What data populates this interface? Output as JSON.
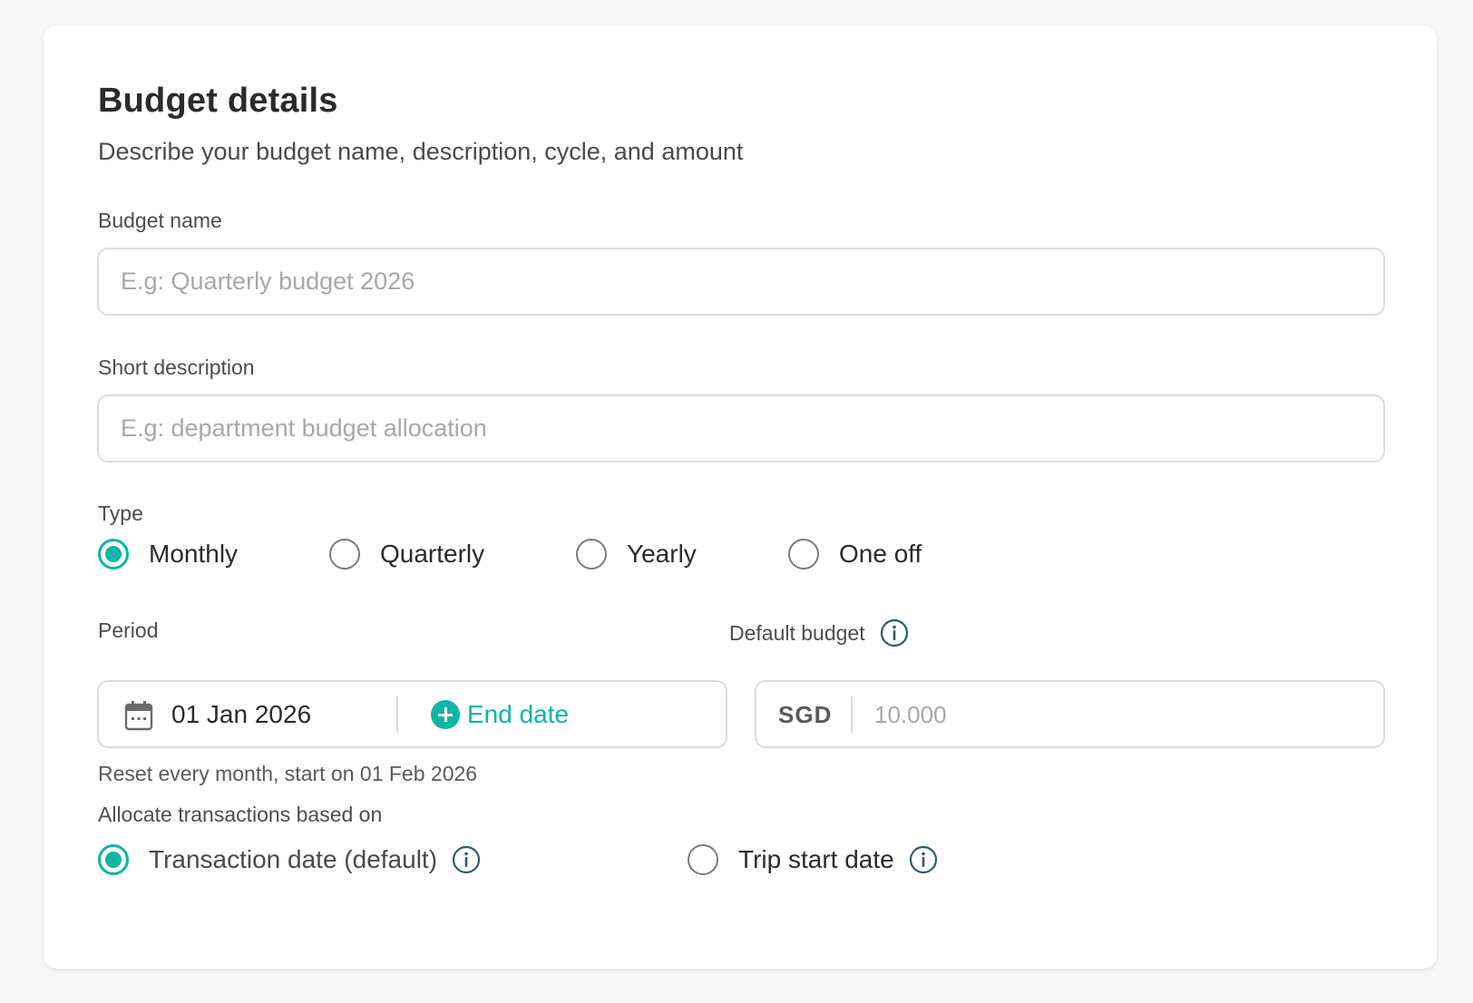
{
  "header": {
    "title": "Budget details",
    "subtitle": "Describe your budget name, description, cycle, and amount"
  },
  "budget_name": {
    "label": "Budget name",
    "value": "",
    "placeholder": "E.g: Quarterly budget 2026"
  },
  "short_description": {
    "label": "Short description",
    "value": "",
    "placeholder": "E.g: department budget allocation"
  },
  "type": {
    "label": "Type",
    "options": [
      {
        "label": "Monthly",
        "checked": true
      },
      {
        "label": "Quarterly",
        "checked": false
      },
      {
        "label": "Yearly",
        "checked": false
      },
      {
        "label": "One off",
        "checked": false
      }
    ]
  },
  "period": {
    "label": "Period",
    "start_date": "01 Jan 2026",
    "end_date_label": "End date",
    "helper": "Reset every month, start on 01 Feb 2026"
  },
  "default_budget": {
    "label": "Default budget",
    "currency": "SGD",
    "value": "",
    "placeholder": "10.000"
  },
  "allocate": {
    "label": "Allocate transactions based on",
    "options": [
      {
        "label": "Transaction date (default)",
        "checked": true
      },
      {
        "label": "Trip start date",
        "checked": false
      }
    ]
  },
  "colors": {
    "accent": "#10b5a6",
    "info_icon": "#2f5d6b",
    "border": "#dcdcdc",
    "placeholder": "#a8a8a8"
  },
  "icons": {
    "calendar": "calendar-icon",
    "add": "plus-circle-icon",
    "info": "info-icon"
  }
}
